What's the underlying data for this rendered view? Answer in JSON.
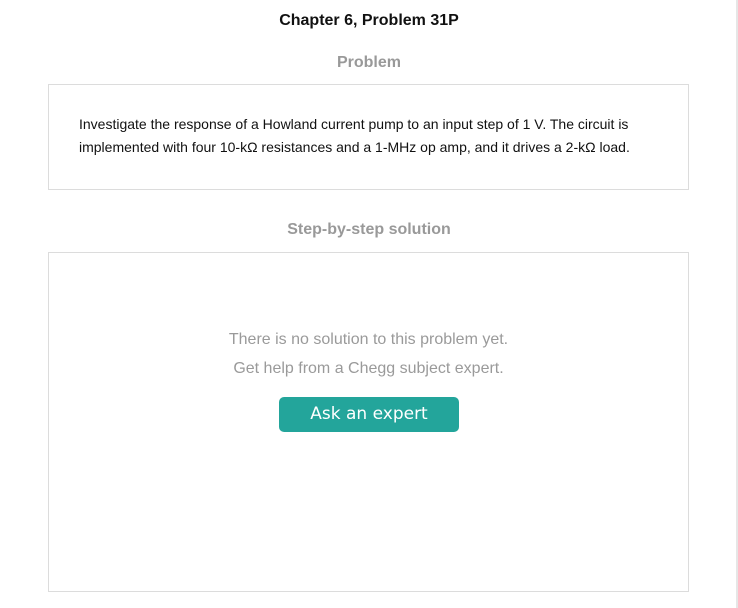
{
  "header": {
    "chapter_title": "Chapter 6, Problem 31P"
  },
  "problem": {
    "heading": "Problem",
    "text": "Investigate the response of a Howland current pump to an input step of 1 V. The circuit is implemented with four 10-kΩ resistances and a 1-MHz op amp, and it drives a 2-kΩ load."
  },
  "solution": {
    "heading": "Step-by-step solution",
    "no_solution_line1": "There is no solution to this problem yet.",
    "no_solution_line2": "Get help from a Chegg subject expert.",
    "ask_button_label": "Ask an expert"
  },
  "colors": {
    "accent": "#23a59b",
    "heading_gray": "#999999",
    "border": "#dcdcdc"
  }
}
